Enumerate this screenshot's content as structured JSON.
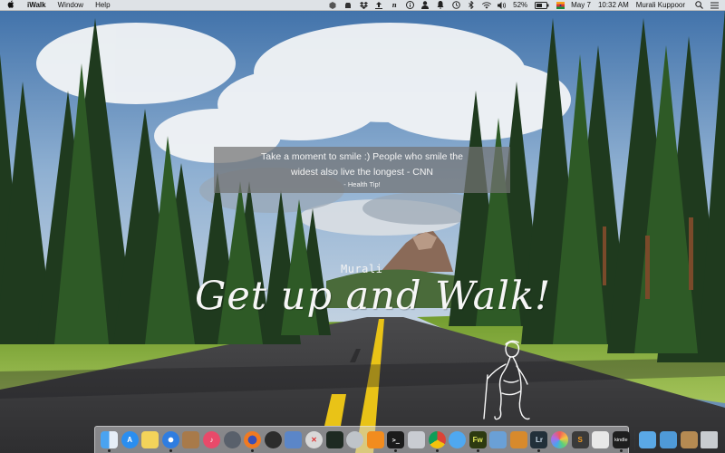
{
  "menubar": {
    "app_name": "iWalk",
    "menus": [
      "Window",
      "Help"
    ],
    "battery": "52%",
    "date": "May 7",
    "time": "10:32 AM",
    "user": "Murali Kuppoor"
  },
  "notification": {
    "message": "Take a moment to smile :) People who smile the widest also live the longest - CNN",
    "source": "- Health Tip!"
  },
  "overlay": {
    "watermark": "Murali",
    "headline": "Get up and Walk!"
  },
  "dock": {
    "fw_label": "Fw",
    "lr_label": "Lr",
    "kindle_label": "kindle"
  },
  "colors": {
    "menubar_bg": "#ececec",
    "banner_bg": "#737373",
    "headline_text": "#f6f6f6"
  }
}
